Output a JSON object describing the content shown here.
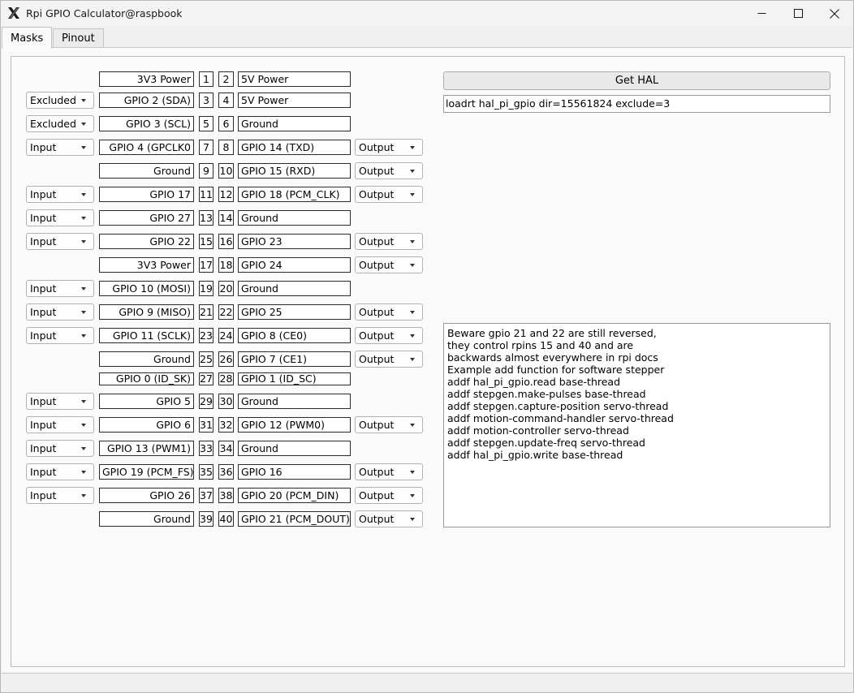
{
  "window": {
    "title": "Rpi GPIO Calculator@raspbook"
  },
  "tabs": [
    {
      "label": "Masks",
      "active": true
    },
    {
      "label": "Pinout",
      "active": false
    }
  ],
  "hal": {
    "get_hal_label": "Get HAL",
    "output_value": "loadrt hal_pi_gpio dir=15561824 exclude=3"
  },
  "notes": {
    "text": "Beware gpio 21 and 22 are still reversed,\nthey control rpins 15 and 40 and are\nbackwards almost everywhere in rpi docs\nExample add function for software stepper\naddf hal_pi_gpio.read base-thread\naddf stepgen.make-pulses base-thread\naddf stepgen.capture-position servo-thread\naddf motion-command-handler servo-thread\naddf motion-controller servo-thread\naddf stepgen.update-freq servo-thread\naddf hal_pi_gpio.write base-thread"
  },
  "pins": [
    {
      "left_mode": null,
      "left_label": "3V3 Power",
      "left_pin": "1",
      "right_pin": "2",
      "right_label": "5V Power",
      "right_mode": null
    },
    {
      "left_mode": "Excluded",
      "left_label": "GPIO 2 (SDA)",
      "left_pin": "3",
      "right_pin": "4",
      "right_label": "5V Power",
      "right_mode": null
    },
    {
      "left_mode": "Excluded",
      "left_label": "GPIO 3 (SCL)",
      "left_pin": "5",
      "right_pin": "6",
      "right_label": "Ground",
      "right_mode": null
    },
    {
      "left_mode": "Input",
      "left_label": "GPIO 4 (GPCLK0",
      "left_pin": "7",
      "right_pin": "8",
      "right_label": "GPIO 14 (TXD)",
      "right_mode": "Output"
    },
    {
      "left_mode": null,
      "left_label": "Ground",
      "left_pin": "9",
      "right_pin": "10",
      "right_label": "GPIO 15 (RXD)",
      "right_mode": "Output"
    },
    {
      "left_mode": "Input",
      "left_label": "GPIO 17",
      "left_pin": "11",
      "right_pin": "12",
      "right_label": "GPIO 18 (PCM_CLK)",
      "right_mode": "Output"
    },
    {
      "left_mode": "Input",
      "left_label": "GPIO 27",
      "left_pin": "13",
      "right_pin": "14",
      "right_label": "Ground",
      "right_mode": null
    },
    {
      "left_mode": "Input",
      "left_label": "GPIO 22",
      "left_pin": "15",
      "right_pin": "16",
      "right_label": "GPIO 23",
      "right_mode": "Output"
    },
    {
      "left_mode": null,
      "left_label": "3V3 Power",
      "left_pin": "17",
      "right_pin": "18",
      "right_label": "GPIO 24",
      "right_mode": "Output"
    },
    {
      "left_mode": "Input",
      "left_label": "GPIO 10 (MOSI)",
      "left_pin": "19",
      "right_pin": "20",
      "right_label": "Ground",
      "right_mode": null
    },
    {
      "left_mode": "Input",
      "left_label": "GPIO 9 (MISO)",
      "left_pin": "21",
      "right_pin": "22",
      "right_label": "GPIO 25",
      "right_mode": "Output"
    },
    {
      "left_mode": "Input",
      "left_label": "GPIO 11 (SCLK)",
      "left_pin": "23",
      "right_pin": "24",
      "right_label": "GPIO 8 (CE0)",
      "right_mode": "Output"
    },
    {
      "left_mode": null,
      "left_label": "Ground",
      "left_pin": "25",
      "right_pin": "26",
      "right_label": "GPIO 7 (CE1)",
      "right_mode": "Output"
    },
    {
      "left_mode": null,
      "left_label": "GPIO 0 (ID_SK)",
      "left_pin": "27",
      "right_pin": "28",
      "right_label": "GPIO 1 (ID_SC)",
      "right_mode": null
    },
    {
      "left_mode": "Input",
      "left_label": "GPIO 5",
      "left_pin": "29",
      "right_pin": "30",
      "right_label": "Ground",
      "right_mode": null
    },
    {
      "left_mode": "Input",
      "left_label": "GPIO 6",
      "left_pin": "31",
      "right_pin": "32",
      "right_label": "GPIO 12 (PWM0)",
      "right_mode": "Output"
    },
    {
      "left_mode": "Input",
      "left_label": "GPIO 13 (PWM1)",
      "left_pin": "33",
      "right_pin": "34",
      "right_label": "Ground",
      "right_mode": null
    },
    {
      "left_mode": "Input",
      "left_label": "GPIO 19 (PCM_FS)",
      "left_pin": "35",
      "right_pin": "36",
      "right_label": "GPIO 16",
      "right_mode": "Output"
    },
    {
      "left_mode": "Input",
      "left_label": "GPIO 26",
      "left_pin": "37",
      "right_pin": "38",
      "right_label": "GPIO 20 (PCM_DIN)",
      "right_mode": "Output"
    },
    {
      "left_mode": null,
      "left_label": "Ground",
      "left_pin": "39",
      "right_pin": "40",
      "right_label": "GPIO 21 (PCM_DOUT)",
      "right_mode": "Output"
    }
  ]
}
